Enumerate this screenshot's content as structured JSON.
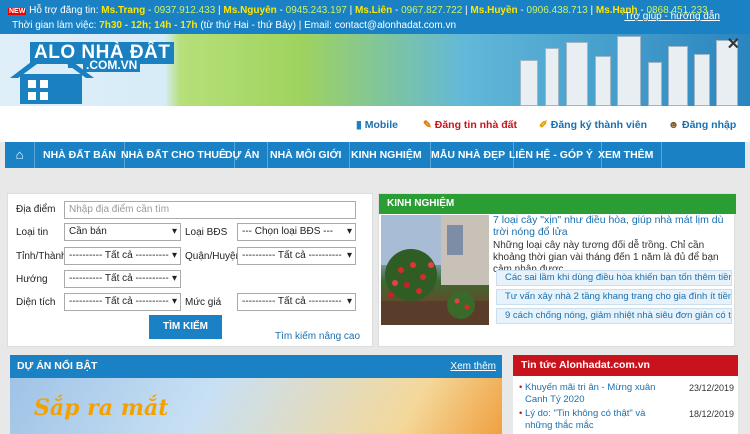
{
  "topbar": {
    "support_prefix": "Hỗ trợ đăng tin:",
    "contacts": [
      {
        "name": "Ms.Trang",
        "phone": "0937.912.433"
      },
      {
        "name": "Ms.Nguyên",
        "phone": "0945.243.197"
      },
      {
        "name": "Ms.Liên",
        "phone": "0967.827.722"
      },
      {
        "name": "Ms.Huyền",
        "phone": "0906.438.713"
      },
      {
        "name": "Ms.Hạnh",
        "phone": "0868.451.233"
      }
    ],
    "hours_prefix": "Thời gian làm việc:",
    "hours": "7h30 - 12h; 14h - 17h",
    "hours_note": "(từ thứ Hai - thứ Bảy) | Email: contact@alonhadat.com.vn",
    "help_link": "Trợ giúp - hướng dẫn",
    "new_badge": "NEW"
  },
  "logo": {
    "main": "ALO NHÀ ĐẤT",
    "sub": ".COM.VN"
  },
  "subbar": {
    "mobile": "Mobile",
    "post": "Đăng tin nhà đất",
    "register": "Đăng ký thành viên",
    "login": "Đăng nhập"
  },
  "nav": [
    "NHÀ ĐẤT BÁN",
    "NHÀ ĐẤT CHO THUÊ",
    "DỰ ÁN",
    "NHÀ MÔI GIỚI",
    "KINH NGHIỆM",
    "MẪU NHÀ ĐẸP",
    "LIÊN HỆ - GÓP Ý",
    "XEM THÊM"
  ],
  "search": {
    "location_label": "Địa điểm",
    "location_placeholder": "Nhập địa điểm cần tìm",
    "type_label": "Loại tin",
    "type_value": "Cần bán",
    "bds_label": "Loại BĐS",
    "bds_value": "--- Chọn loại BĐS ---",
    "province_label": "Tỉnh/Thành",
    "province_value": "---------- Tất cả ----------",
    "district_label": "Quận/Huyện",
    "district_value": "---------- Tất cả ----------",
    "direction_label": "Hướng",
    "direction_value": "---------- Tất cả ----------",
    "area_label": "Diện tích",
    "area_value": "---------- Tất cả ----------",
    "price_label": "Mức giá",
    "price_value": "---------- Tất cả ----------",
    "submit": "TÌM KIẾM",
    "advanced": "Tìm kiếm nâng cao"
  },
  "kinh_nghiem": {
    "header": "KINH NGHIỆM",
    "title": "7 loại cây \"xịn\" như điều hòa, giúp nhà mát lịm dù trời nóng đổ lửa",
    "desc": "Những loại cây này tương đối dễ trồng. Chỉ cần khoảng thời gian vài tháng đến 1 năm là đủ để bạn cảm nhận được",
    "links": [
      "Các sai lầm khi dùng điều hòa khiến bạn tốn thêm tiền vô",
      "Tư vấn xây nhà 2 tầng khang trang cho gia đình ít tiền",
      "9 cách chống nóng, giảm nhiệt nhà siêu đơn giản có thể"
    ]
  },
  "du_an": {
    "header": "DỰ ÁN NỔI BẬT",
    "more": "Xem thêm",
    "banner_text": "Sắp ra mắt"
  },
  "tin_tuc": {
    "header": "Tin tức Alonhadat.com.vn",
    "items": [
      {
        "title": "Khuyến mãi tri ân - Mừng xuân Canh Tý 2020",
        "date": "23/12/2019"
      },
      {
        "title": "Lý do: \"Tin không có thật\" và những thắc mắc",
        "date": "18/12/2019"
      }
    ]
  },
  "colors": {
    "brand_blue": "#1a82c4",
    "green": "#2b9d35",
    "red": "#c8131d",
    "yellow": "#ffe600"
  }
}
